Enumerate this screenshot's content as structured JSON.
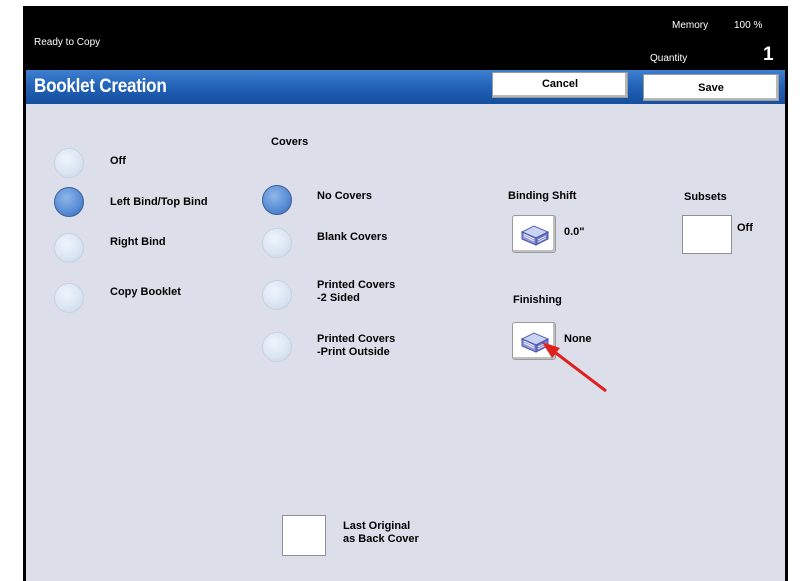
{
  "status": {
    "text": "Ready to Copy",
    "memory_label": "Memory",
    "memory_value": "100 %",
    "quantity_label": "Quantity",
    "quantity_value": "1"
  },
  "header": {
    "title": "Booklet Creation",
    "cancel_label": "Cancel",
    "save_label": "Save"
  },
  "binding_options": {
    "items": [
      {
        "label": "Off",
        "selected": false
      },
      {
        "label": "Left Bind/Top Bind",
        "selected": true
      },
      {
        "label": "Right Bind",
        "selected": false
      },
      {
        "label": "Copy Booklet",
        "selected": false
      }
    ]
  },
  "covers": {
    "heading": "Covers",
    "items": [
      {
        "label": "No Covers",
        "selected": true
      },
      {
        "label": "Blank Covers",
        "selected": false
      },
      {
        "label": "Printed Covers\n-2 Sided",
        "selected": false
      },
      {
        "label": "Printed Covers\n-Print Outside",
        "selected": false
      }
    ]
  },
  "binding_shift": {
    "label": "Binding Shift",
    "value": "0.0\"",
    "icon": "pages-icon"
  },
  "finishing": {
    "label": "Finishing",
    "value": "None",
    "icon": "pages-icon"
  },
  "subsets": {
    "label": "Subsets",
    "value": "Off"
  },
  "last_original": {
    "label": "Last Original\nas Back Cover",
    "checked": false
  },
  "annotation": {
    "color": "#e0201c"
  }
}
